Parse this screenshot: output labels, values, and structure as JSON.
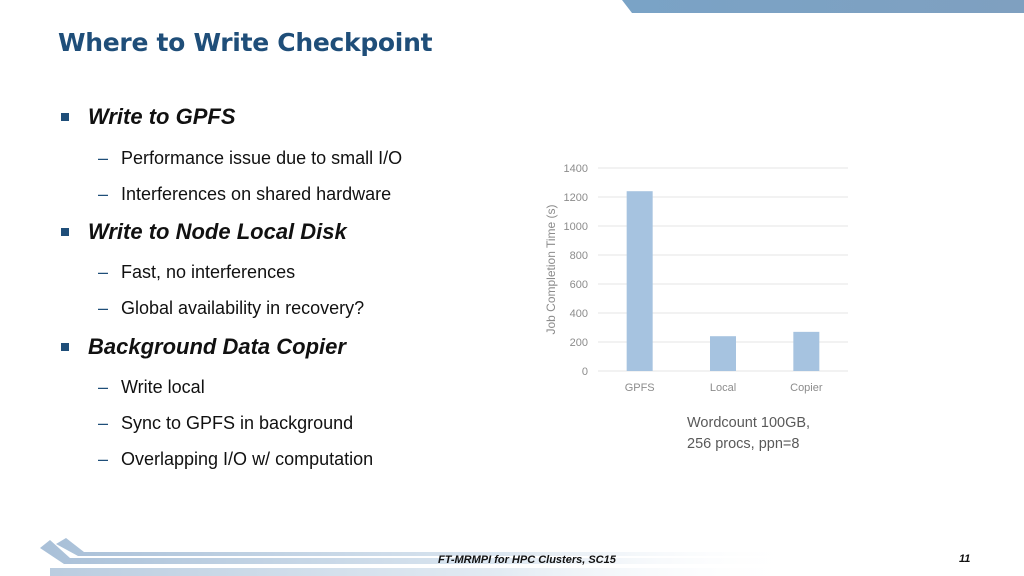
{
  "slide": {
    "title": "Where to Write Checkpoint",
    "footer": "FT-MRMPI for HPC Clusters, SC15",
    "page_number": "11",
    "accent_color": "#1f4e79"
  },
  "bullets": [
    {
      "text": "Write to GPFS",
      "sub": [
        "Performance issue due to small I/O",
        "Interferences on shared hardware"
      ]
    },
    {
      "text": "Write to Node Local Disk",
      "sub": [
        "Fast, no interferences",
        "Global availability in recovery?"
      ]
    },
    {
      "text": "Background Data Copier",
      "sub": [
        "Write local",
        "Sync to GPFS in background",
        "Overlapping I/O w/ computation"
      ]
    }
  ],
  "chart_note": [
    "Wordcount 100GB,",
    "256 procs, ppn=8"
  ],
  "chart_data": {
    "type": "bar",
    "title": "",
    "categories": [
      "GPFS",
      "Local",
      "Copier"
    ],
    "values": [
      1240,
      240,
      270
    ],
    "xlabel": "",
    "ylabel": "Job Completion Time (s)",
    "ylim": [
      0,
      1400
    ],
    "yticks": [
      0,
      200,
      400,
      600,
      800,
      1000,
      1200,
      1400
    ],
    "grid": true,
    "legend": "none",
    "bar_color": "#a6c3e0"
  }
}
